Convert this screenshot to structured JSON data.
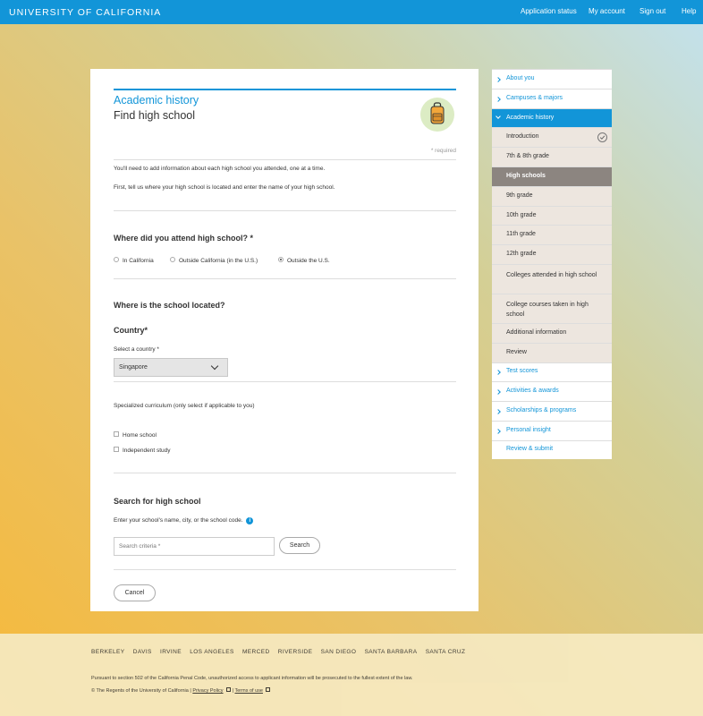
{
  "header": {
    "brand": "UNIVERSITY OF CALIFORNIA",
    "nav": [
      "Application status",
      "My account",
      "Sign out",
      "Help"
    ]
  },
  "main": {
    "section_title": "Academic history",
    "page_title": "Find high school",
    "required_note": "* required",
    "intro_1": "You'll need to add information about each high school you attended, one at a time.",
    "intro_2": "First, tell us where your high school is located and enter the name of your high school.",
    "attend_question": "Where did you attend high school? *",
    "attend_options": [
      "In California",
      "Outside California (in the U.S.)",
      "Outside the U.S."
    ],
    "attend_selected": "Outside the U.S.",
    "location_question": "Where is the school located?",
    "country_heading": "Country*",
    "select_country_label": "Select a country *",
    "country_value": "Singapore",
    "curriculum_label": "Specialized curriculum (only select if applicable to you)",
    "curriculum_options": [
      "Home school",
      "Independent study"
    ],
    "search_heading": "Search for high school",
    "search_instructions": "Enter your school's name, city, or the school code.",
    "search_placeholder": "Search criteria *",
    "search_button": "Search",
    "cancel_button": "Cancel"
  },
  "sidebar": {
    "items": [
      {
        "label": "About you",
        "type": "top"
      },
      {
        "label": "Campuses & majors",
        "type": "top"
      },
      {
        "label": "Academic history",
        "type": "active"
      },
      {
        "label": "Introduction",
        "type": "sub"
      },
      {
        "label": "7th & 8th grade",
        "type": "sub"
      },
      {
        "label": "High schools",
        "type": "current"
      },
      {
        "label": "9th grade",
        "type": "sub"
      },
      {
        "label": "10th grade",
        "type": "sub"
      },
      {
        "label": "11th grade",
        "type": "sub"
      },
      {
        "label": "12th grade",
        "type": "sub"
      },
      {
        "label": "Colleges attended in high school",
        "type": "sub"
      },
      {
        "label": "College courses taken in high school",
        "type": "sub"
      },
      {
        "label": "Additional information",
        "type": "sub"
      },
      {
        "label": "Review",
        "type": "sub"
      },
      {
        "label": "Test scores",
        "type": "top"
      },
      {
        "label": "Activities & awards",
        "type": "top"
      },
      {
        "label": "Scholarships & programs",
        "type": "top"
      },
      {
        "label": "Personal insight",
        "type": "top"
      },
      {
        "label": "Review & submit",
        "type": "plain"
      }
    ]
  },
  "footer": {
    "campuses": [
      "BERKELEY",
      "DAVIS",
      "IRVINE",
      "LOS ANGELES",
      "MERCED",
      "RIVERSIDE",
      "SAN DIEGO",
      "SANTA BARBARA",
      "SANTA CRUZ"
    ],
    "legal": "Pursuant to section 502 of the California Penal Code, unauthorized access to applicant information will be prosecuted to the fullest extent of the law.",
    "copyright": "© The Regents of the University of California",
    "privacy": "Privacy Policy",
    "terms": "Terms of use"
  },
  "colors": {
    "brand_blue": "#1295d8",
    "current_item": "#8c8580",
    "sub_item": "#ede6df"
  }
}
